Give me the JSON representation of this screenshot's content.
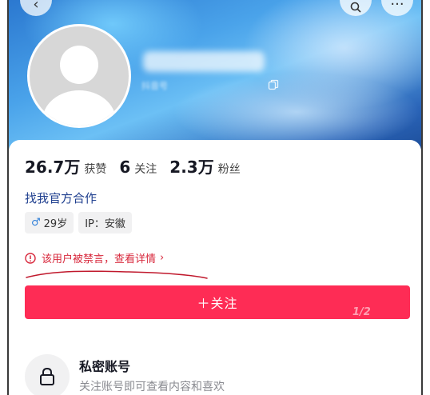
{
  "profile": {
    "id_text": "抖音号"
  },
  "stats": [
    {
      "value": "26.7万",
      "label": "获赞"
    },
    {
      "value": "6",
      "label": "关注"
    },
    {
      "value": "2.3万",
      "label": "粉丝"
    }
  ],
  "cooperate_label": "找我官方合作",
  "tags": {
    "gender_symbol": "♂",
    "age": "29岁",
    "ip": "IP：安徽"
  },
  "ban_notice": {
    "text": "该用户被禁言，查看详情",
    "chevron": "›"
  },
  "follow_button": {
    "label": "＋关注"
  },
  "watermark": "1/2",
  "private": {
    "title": "私密账号",
    "description": "关注账号即可查看内容和喜欢"
  },
  "colors": {
    "accent": "#fe2c55",
    "ban_text": "#d8283c",
    "link": "#1f3f8f",
    "gender": "#2f7fd8"
  },
  "icons": {
    "back": "back-icon",
    "search": "search-icon",
    "more": "more-icon",
    "copy": "copy-icon",
    "warning": "warning-icon",
    "lock": "lock-icon"
  }
}
